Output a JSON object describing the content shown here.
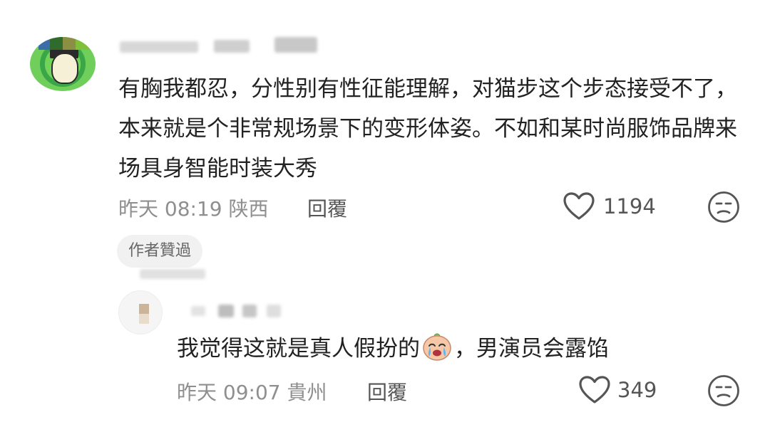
{
  "comment": {
    "text": "有胸我都忍，分性别有性征能理解，对猫步这个步态接受不了，本来就是个非常规场景下的变形体姿。不如和某时尚服饰品牌来场具身智能时装大秀",
    "time": "昨天 08:19",
    "location": "陕西",
    "reply_label": "回覆",
    "like_count": "1194",
    "author_badge": "作者贊過"
  },
  "reply": {
    "text_before": "我觉得这就是真人假扮的",
    "emoji": "crying-face-emoji",
    "text_after": "，男演员会露馅",
    "time": "昨天 09:07",
    "location": "貴州",
    "reply_label": "回覆",
    "like_count": "349"
  },
  "icons": {
    "like": "heart-outline-icon",
    "dislike": "unamused-face-icon"
  }
}
